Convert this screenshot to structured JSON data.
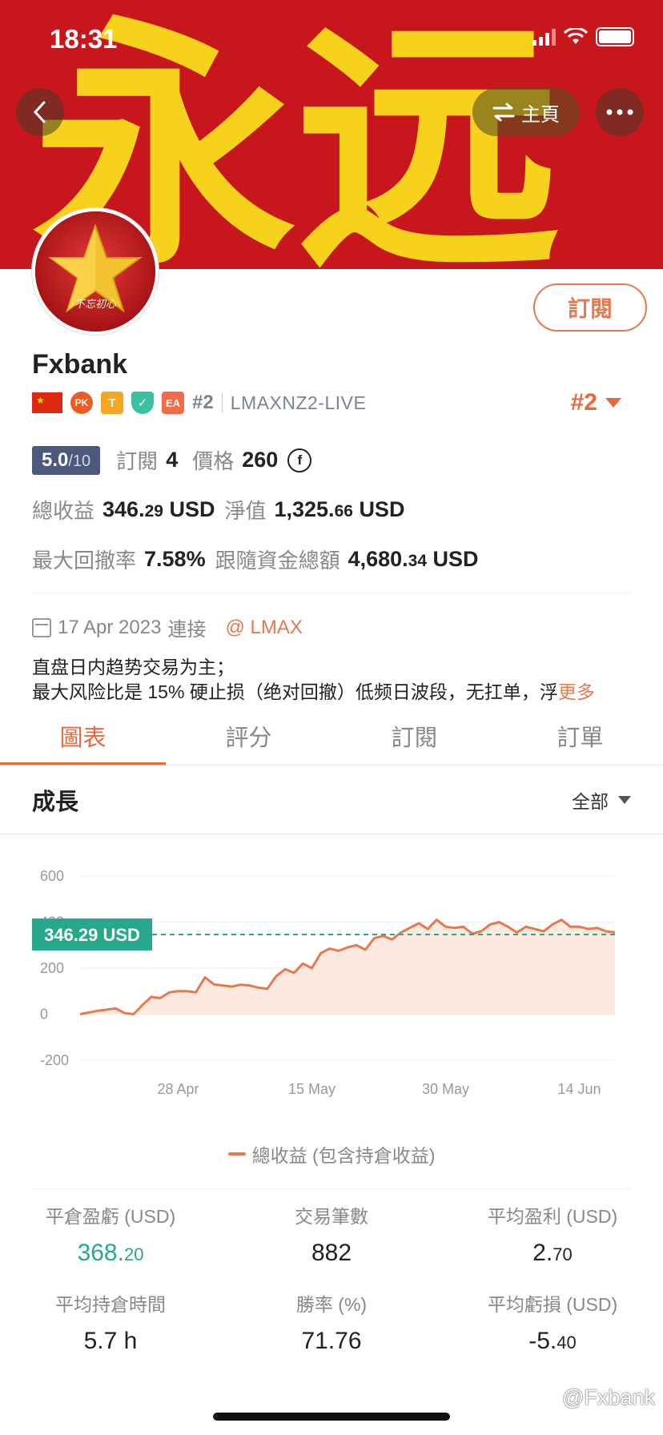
{
  "status_bar": {
    "time": "18:31"
  },
  "banner": {
    "decor_text": "永远"
  },
  "nav": {
    "home_label": "主頁"
  },
  "profile": {
    "avatar_text": "不忘初心",
    "subscribe_label": "訂閱",
    "name": "Fxbank",
    "badges": {
      "pk": "PK",
      "t": "T",
      "ea": "EA"
    },
    "rank_small": "#2",
    "broker": "LMAXNZ2-LIVE",
    "rank_big": "#2"
  },
  "summary": {
    "score": "5.0",
    "score_max": "/10",
    "subscribers_label": "訂閱",
    "subscribers": "4",
    "price_label": "價格",
    "price": "260",
    "coin_symbol": "f",
    "total_profit_label": "總收益",
    "total_profit_int": "346.",
    "total_profit_dec": "29",
    "total_profit_unit": "USD",
    "equity_label": "淨值",
    "equity_int": "1,325.",
    "equity_dec": "66",
    "equity_unit": "USD",
    "max_drawdown_label": "最大回撤率",
    "max_drawdown": "7.58%",
    "follow_funds_label": "跟隨資金總額",
    "follow_funds_int": "4,680.",
    "follow_funds_dec": "34",
    "follow_funds_unit": "USD"
  },
  "connection": {
    "date": "17 Apr 2023",
    "label": "連接",
    "broker_link": "@ LMAX"
  },
  "description": {
    "line1": "直盘日内趋势交易为主；",
    "line2": "最大风险比是 15% 硬止损（绝对回撤）低频日波段，无扛单，浮",
    "more": "更多"
  },
  "tabs": [
    "圖表",
    "評分",
    "訂閱",
    "訂單"
  ],
  "growth": {
    "title": "成長",
    "range": "全部"
  },
  "chart_data": {
    "type": "area",
    "title": "成長",
    "series": [
      {
        "name": "總收益 (包含持倉收益)",
        "color": "#e8794e",
        "x_days": [
          0,
          2,
          4,
          5,
          6,
          7,
          8,
          9,
          10,
          11,
          12,
          13,
          14,
          15,
          16,
          17,
          18,
          19,
          20,
          21,
          22,
          23,
          24,
          25,
          26,
          27,
          28,
          29,
          30,
          31,
          32,
          33,
          34,
          35,
          36,
          37,
          38,
          39,
          40,
          41,
          42,
          43,
          44,
          45,
          46,
          47,
          48,
          49,
          50,
          51,
          52,
          53,
          54,
          55,
          56,
          57,
          58,
          59,
          60
        ],
        "values": [
          0,
          15,
          25,
          5,
          0,
          40,
          75,
          70,
          95,
          100,
          100,
          95,
          160,
          130,
          125,
          120,
          128,
          125,
          115,
          110,
          165,
          195,
          180,
          220,
          200,
          265,
          285,
          275,
          290,
          300,
          280,
          330,
          340,
          325,
          355,
          375,
          395,
          370,
          410,
          380,
          375,
          380,
          350,
          360,
          390,
          400,
          380,
          355,
          380,
          370,
          360,
          390,
          410,
          380,
          380,
          370,
          375,
          360,
          355
        ],
        "x_labels_at": [
          {
            "day": 11,
            "label": "28 Apr"
          },
          {
            "day": 26,
            "label": "15 May"
          },
          {
            "day": 41,
            "label": "30 May"
          },
          {
            "day": 56,
            "label": "14 Jun"
          }
        ]
      }
    ],
    "y_ticks": [
      600,
      400,
      200,
      0,
      -200
    ],
    "ylim": [
      -200,
      600
    ],
    "current_value_label": "346.29 USD",
    "current_value": 346.29,
    "current_color": "#26a88c",
    "grid": true,
    "legend": "bottom"
  },
  "stats": [
    {
      "label": "平倉盈虧 (USD)",
      "int": "368.",
      "dec": "20",
      "positive": true
    },
    {
      "label": "交易筆數",
      "int": "882",
      "dec": ""
    },
    {
      "label": "平均盈利 (USD)",
      "int": "2.",
      "dec": "70"
    },
    {
      "label": "平均持倉時間",
      "int": "5.7 h",
      "dec": ""
    },
    {
      "label": "勝率 (%)",
      "int": "71.76",
      "dec": ""
    },
    {
      "label": "平均虧損 (USD)",
      "int": "-5.",
      "dec": "40"
    }
  ],
  "watermark": "@Fxbank"
}
